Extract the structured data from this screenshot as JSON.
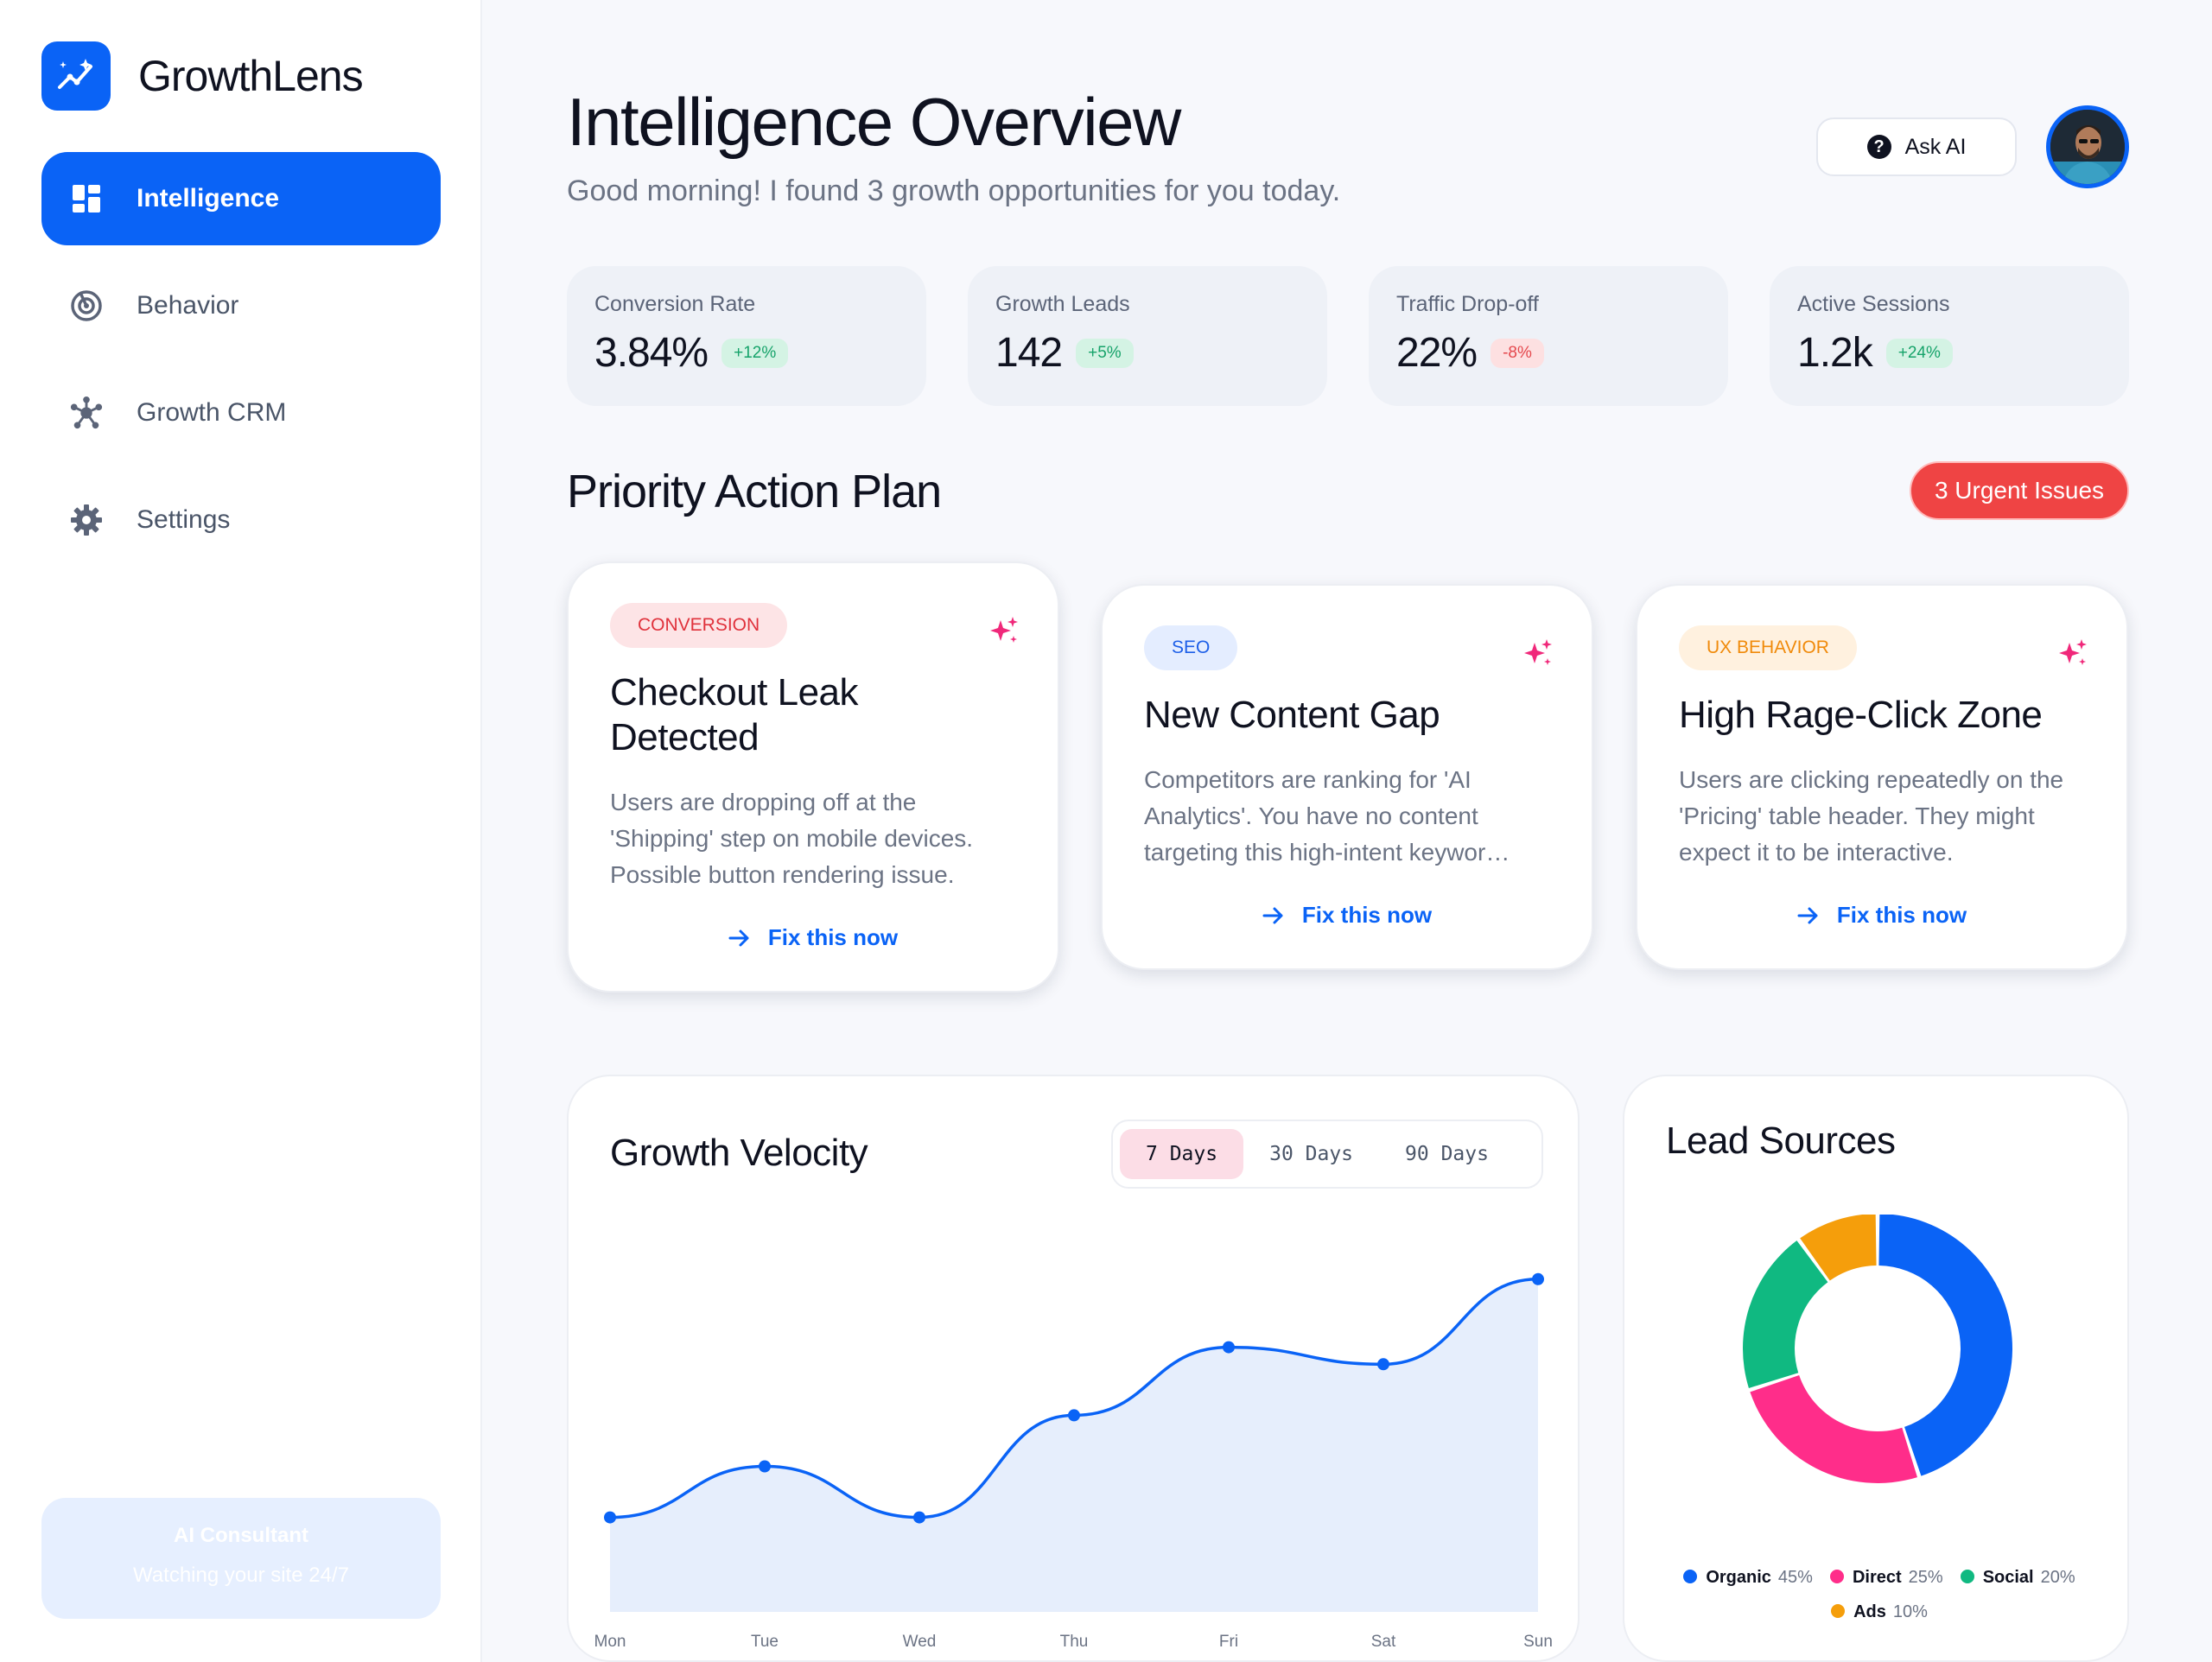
{
  "app": {
    "name": "GrowthLens"
  },
  "sidebar": {
    "items": [
      {
        "label": "Intelligence",
        "icon": "dashboard-icon",
        "active": true
      },
      {
        "label": "Behavior",
        "icon": "radar-icon",
        "active": false
      },
      {
        "label": "Growth CRM",
        "icon": "network-icon",
        "active": false
      },
      {
        "label": "Settings",
        "icon": "gear-icon",
        "active": false
      }
    ],
    "consultant": {
      "title": "AI Consultant",
      "subtitle": "Watching your site 24/7"
    }
  },
  "header": {
    "title": "Intelligence Overview",
    "subtitle": "Good morning! I found 3 growth opportunities for you today.",
    "ask_ai_label": "Ask AI"
  },
  "kpis": [
    {
      "label": "Conversion Rate",
      "value": "3.84%",
      "delta": "+12%",
      "trend": "up"
    },
    {
      "label": "Growth Leads",
      "value": "142",
      "delta": "+5%",
      "trend": "up"
    },
    {
      "label": "Traffic Drop-off",
      "value": "22%",
      "delta": "-8%",
      "trend": "down"
    },
    {
      "label": "Active Sessions",
      "value": "1.2k",
      "delta": "+24%",
      "trend": "up"
    }
  ],
  "action_plan": {
    "title": "Priority Action Plan",
    "urgent_label": "3 Urgent Issues",
    "cards": [
      {
        "tag": "CONVERSION",
        "title": "Checkout Leak Detected",
        "body": "Users are dropping off at the 'Shipping' step on mobile devices. Possible button rendering issue.",
        "cta": "Fix this now"
      },
      {
        "tag": "SEO",
        "title": "New Content Gap",
        "body": "Competitors are ranking for 'AI Analytics'. You have no content targeting this high-intent keywor…",
        "cta": "Fix this now"
      },
      {
        "tag": "UX BEHAVIOR",
        "title": "High Rage-Click Zone",
        "body": "Users are clicking repeatedly on the 'Pricing' table header. They might expect it to be interactive.",
        "cta": "Fix this now"
      }
    ]
  },
  "velocity": {
    "title": "Growth Velocity",
    "ranges": [
      "7 Days",
      "30 Days",
      "90 Days"
    ],
    "selected_range": "7 Days"
  },
  "lead_sources": {
    "title": "Lead Sources"
  },
  "colors": {
    "accent": "#0a63f6",
    "urgent": "#ef4444",
    "organic": "#0a63f6",
    "direct": "#ff2d8a",
    "social": "#10b981",
    "ads": "#f59e0b"
  },
  "chart_data": [
    {
      "type": "area",
      "categories": [
        "Mon",
        "Tue",
        "Wed",
        "Thu",
        "Fri",
        "Sat",
        "Sun"
      ],
      "series": [
        {
          "values": [
            12,
            30,
            12,
            48,
            72,
            66,
            96
          ]
        }
      ],
      "ylim": [
        0,
        120
      ],
      "grid": false
    },
    {
      "type": "pie",
      "donut": true,
      "labels": [
        "Organic",
        "Direct",
        "Social",
        "Ads"
      ],
      "display": [
        "45%",
        "25%",
        "20%",
        "10%"
      ],
      "values": [
        45,
        25,
        20,
        10
      ],
      "legend": "bottom"
    }
  ]
}
